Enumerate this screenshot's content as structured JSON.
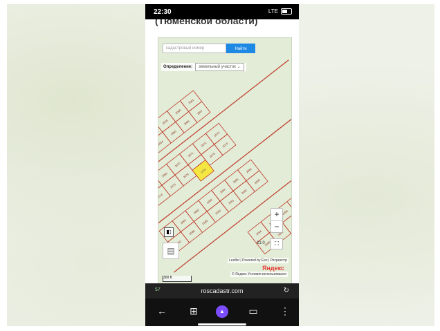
{
  "status": {
    "time": "22:30",
    "network": "LTE",
    "battery_level": 0.6
  },
  "page": {
    "heading": "(Тюменской области)"
  },
  "map": {
    "search_placeholder": "кадастровый номер",
    "search_button": "Найти",
    "definition_label": "Определение:",
    "definition_value": "земельный участок",
    "zoom_in": "+",
    "zoom_out": "−",
    "scale_value": "21:0",
    "attribution": "Leaflet | Powered by Esri | Росреестр",
    "attribution2": "© Яндекс Условия использования",
    "provider": "Яндекс",
    "scalebar": "300 ft",
    "highlighted_parcel": "1970",
    "parcels": [
      "2055",
      "2057",
      "2058",
      "2059",
      "2060",
      "2061",
      "2062",
      "2063",
      "2064",
      "2065",
      "2066",
      "2067",
      "2068",
      "2069",
      "2070",
      "2071",
      "2072",
      "2073",
      "2074",
      "2075",
      "2076",
      "2077",
      "2078",
      "2079",
      "2080",
      "2081",
      "2082",
      "2083",
      "2084",
      "2085",
      "2086",
      "2087",
      "2088",
      "2089",
      "2090",
      "2091",
      "2092",
      "2093",
      "2094",
      "2095",
      "2096",
      "2097",
      "2098",
      "2099"
    ]
  },
  "browser": {
    "url": "roscadastr.com",
    "tabs_count": "57"
  },
  "colors": {
    "highlight": "#f5e642",
    "parcel_line": "#c0392b",
    "search_button": "#1e88e5"
  }
}
